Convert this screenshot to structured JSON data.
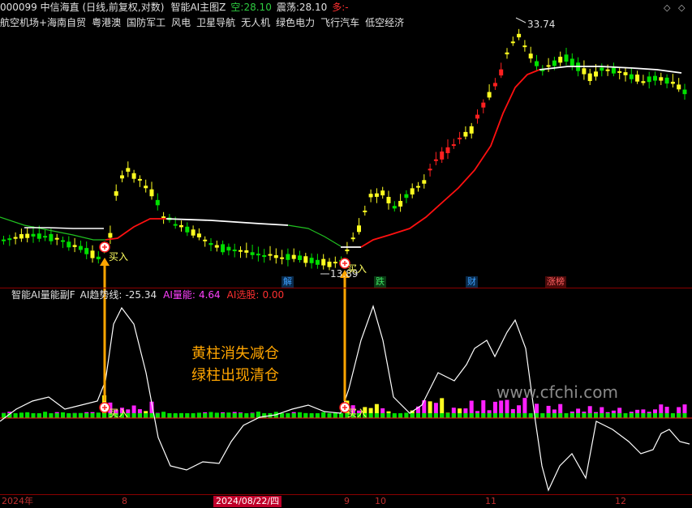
{
  "header": {
    "code_name": "000099 中信海直 (日线,前复权,对数)",
    "indicator": "智能AI主图Z",
    "kong_label": "空:",
    "kong_value": "28.10",
    "zhendang_label": "震荡:",
    "zhendang_value": "28.10",
    "duo_label": "多:",
    "duo_value": "-"
  },
  "concepts": [
    "航空机场+海南自贸",
    "粤港澳",
    "国防军工",
    "风电",
    "卫星导航",
    "无人机",
    "绿色电力",
    "飞行汽车",
    "低空经济"
  ],
  "window_buttons": [
    "◇",
    "◇"
  ],
  "main_chart": {
    "high_label": "33.74",
    "low_label": "13.89",
    "buy_label_1": "买入",
    "buy_label_2": "买入",
    "event_markers": [
      {
        "label": "解",
        "color": "#1e90ff"
      },
      {
        "label": "跌",
        "color": "#2ecc40"
      },
      {
        "label": "财",
        "color": "#1e90ff"
      },
      {
        "label": "涨榜",
        "color": "#ff5050"
      }
    ]
  },
  "sub_header": {
    "name": "智能AI量能副F",
    "trend_label": "AI趋势线:",
    "trend_value": "-25.34",
    "energy_label": "AI量能:",
    "energy_value": "4.64",
    "select_label": "AI选股:",
    "select_value": "0.00"
  },
  "sub_chart": {
    "buy_label_1": "买入",
    "buy_label_2": "买入",
    "tip_line1": "黄柱消失减仓",
    "tip_line2": "绿柱出现清仓",
    "watermark": "www.cfchi.com"
  },
  "x_axis": {
    "labels": [
      "2024年",
      "8",
      "2024/08/22/四",
      "9",
      "10",
      "11",
      "12"
    ]
  },
  "colors": {
    "up": "#ff2020",
    "down": "#00e000",
    "yellow": "#ffff20",
    "magenta": "#ff20ff",
    "ma_red": "#ff1010",
    "ma_white": "#ffffff",
    "ma_green": "#20c020",
    "arrow": "#ffa500"
  }
}
